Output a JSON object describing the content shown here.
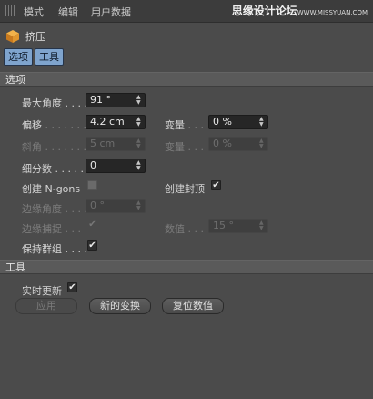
{
  "menubar": {
    "items": [
      "模式",
      "编辑",
      "用户数据"
    ],
    "watermark_main": "思缘设计论坛",
    "watermark_sub": "WWW.MISSYUAN.COM"
  },
  "object": {
    "icon": "extrude-cube-icon",
    "title": "挤压"
  },
  "tabs": [
    "选项",
    "工具"
  ],
  "sections": {
    "options": "选项",
    "tools": "工具"
  },
  "options": {
    "max_angle_label": "最大角度",
    "max_angle_value": "91 °",
    "offset_label": "偏移",
    "offset_value": "4.2 cm",
    "variance_label": "变量",
    "variance_value": "0 %",
    "bevel_label": "斜角",
    "bevel_value": "5 cm",
    "bevel_variance_label": "变量",
    "bevel_variance_value": "0 %",
    "subdivision_label": "细分数",
    "subdivision_value": "0",
    "create_ngons_label": "创建 N-gons",
    "create_ngons_checked": false,
    "create_caps_label": "创建封顶",
    "create_caps_checked": true,
    "edge_angle_label": "边缘角度",
    "edge_angle_value": "0 °",
    "edge_snap_label": "边缘捕捉",
    "edge_snap_checked": true,
    "value_label": "数值",
    "value_value": "15 °",
    "keep_groups_label": "保持群组",
    "keep_groups_checked": true
  },
  "tools": {
    "realtime_update_label": "实时更新",
    "realtime_update_checked": true,
    "apply_button": "应用",
    "new_transform_button": "新的变换",
    "reset_values_button": "复位数值"
  },
  "check_glyph": "✔"
}
